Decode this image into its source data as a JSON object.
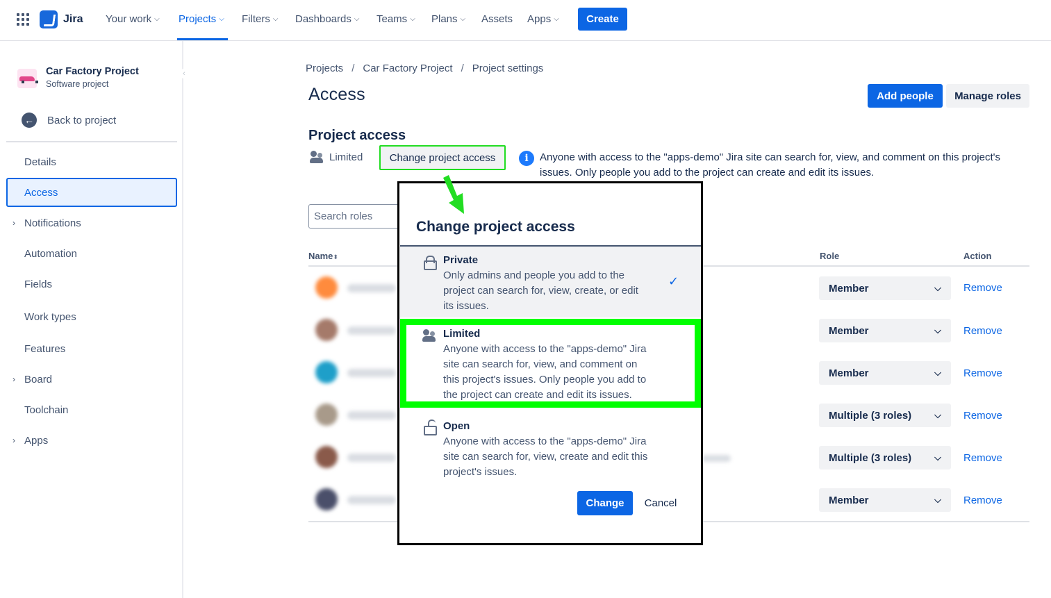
{
  "topnav": {
    "app_name": "Jira",
    "items": [
      {
        "label": "Your work",
        "chevron": true
      },
      {
        "label": "Projects",
        "chevron": true,
        "active": true
      },
      {
        "label": "Filters",
        "chevron": true
      },
      {
        "label": "Dashboards",
        "chevron": true
      },
      {
        "label": "Teams",
        "chevron": true
      },
      {
        "label": "Plans",
        "chevron": true
      },
      {
        "label": "Assets",
        "chevron": false
      },
      {
        "label": "Apps",
        "chevron": true
      }
    ],
    "create_label": "Create"
  },
  "sidebar": {
    "project_name": "Car Factory Project",
    "project_type": "Software project",
    "back_label": "Back to project",
    "items": [
      {
        "label": "Details",
        "expandable": false
      },
      {
        "label": "Access",
        "expandable": false,
        "active": true
      },
      {
        "label": "Notifications",
        "expandable": true
      },
      {
        "label": "Automation",
        "expandable": false
      },
      {
        "label": "Fields",
        "expandable": false
      },
      {
        "label": "Work types",
        "expandable": false
      },
      {
        "label": "Features",
        "expandable": false
      },
      {
        "label": "Board",
        "expandable": true
      },
      {
        "label": "Toolchain",
        "expandable": false
      },
      {
        "label": "Apps",
        "expandable": true
      }
    ]
  },
  "main": {
    "breadcrumb": [
      "Projects",
      "Car Factory Project",
      "Project settings"
    ],
    "breadcrumb_separator": "/",
    "title": "Access",
    "add_people_label": "Add people",
    "manage_roles_label": "Manage roles",
    "section_title": "Project access",
    "current_access": "Limited",
    "change_access_label": "Change project access",
    "info_text": "Anyone with access to the \"apps-demo\" Jira site can search for, view, and comment on this project's issues. Only people you add to the project can create and edit its issues.",
    "search_placeholder": "Search roles",
    "table": {
      "headers": {
        "name": "Name",
        "role": "Role",
        "action": "Action"
      },
      "rows": [
        {
          "role": "Member",
          "action": "Remove",
          "avatar_color": "#ff8b3d"
        },
        {
          "role": "Member",
          "action": "Remove",
          "avatar_color": "#a57a6a"
        },
        {
          "role": "Member",
          "action": "Remove",
          "avatar_color": "#1e9fc9"
        },
        {
          "role": "Multiple (3 roles)",
          "action": "Remove",
          "avatar_color": "#a89a8a"
        },
        {
          "role": "Multiple (3 roles)",
          "action": "Remove",
          "avatar_color": "#8a5a4a"
        },
        {
          "role": "Member",
          "action": "Remove",
          "avatar_color": "#4a4f6a"
        }
      ]
    }
  },
  "modal": {
    "title": "Change project access",
    "options": [
      {
        "name": "Private",
        "description": "Only admins and people you add to the project can search for, view, create, or edit its issues.",
        "selected": true
      },
      {
        "name": "Limited",
        "description": "Anyone with access to the \"apps-demo\" Jira site can search for, view, and comment on this project's issues. Only people you add to the project can create and edit its issues.",
        "selected": false
      },
      {
        "name": "Open",
        "description": "Anyone with access to the \"apps-demo\" Jira site can search for, view, create and edit this project's issues.",
        "selected": false
      }
    ],
    "change_label": "Change",
    "cancel_label": "Cancel"
  },
  "colors": {
    "accent": "#0c66e4",
    "annotation": "#00ff00"
  }
}
